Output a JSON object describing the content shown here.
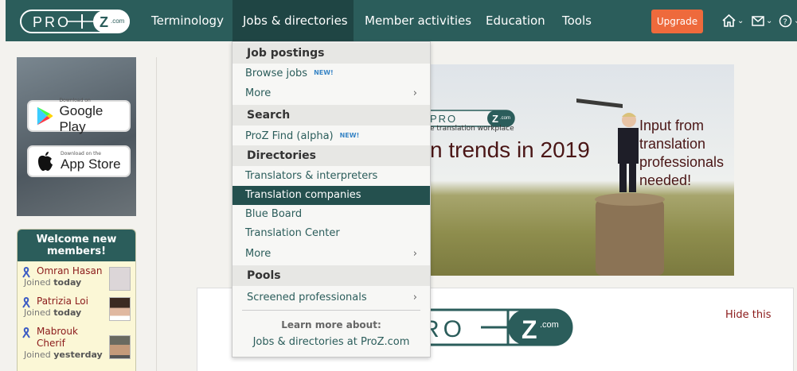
{
  "brand": {
    "logo_text": "PROZ.com"
  },
  "nav": {
    "items": [
      "Terminology",
      "Jobs & directories",
      "Member activities",
      "Education",
      "Tools"
    ],
    "upgrade_label": "Upgrade"
  },
  "dropdown": {
    "sections": {
      "job_postings": "Job postings",
      "search": "Search",
      "directories": "Directories",
      "pools": "Pools"
    },
    "items": {
      "browse_jobs": "Browse jobs",
      "more_1": "More",
      "proz_find": "ProZ Find (alpha)",
      "translators": "Translators & interpreters",
      "translation_companies": "Translation companies",
      "blue_board": "Blue Board",
      "translation_center": "Translation Center",
      "more_2": "More",
      "screened": "Screened professionals"
    },
    "new_badge": "NEW!",
    "learn_more": "Learn more about:",
    "learn_link": "Jobs & directories at ProZ.com"
  },
  "sidebar": {
    "google_play": {
      "small": "Download on",
      "big": "Google Play"
    },
    "app_store": {
      "small": "Download on the",
      "big": "App Store"
    },
    "welcome_title": "Welcome new members!",
    "members": [
      {
        "name": "Omran Hasan",
        "joined": "today"
      },
      {
        "name": "Patrizia Loi",
        "joined": "today"
      },
      {
        "name": "Mabrouk Cherif",
        "joined": "yesterday"
      }
    ],
    "joined_prefix": "Joined"
  },
  "banner": {
    "title": "n trends in 2019",
    "subtitle": "Input from translation professionals needed!",
    "tagline": "e translation workplace"
  },
  "content": {
    "hide_label": "Hide this"
  },
  "colors": {
    "brand": "#2b5d5b",
    "upgrade": "#ee6a3c",
    "link": "#8b1a1a"
  }
}
